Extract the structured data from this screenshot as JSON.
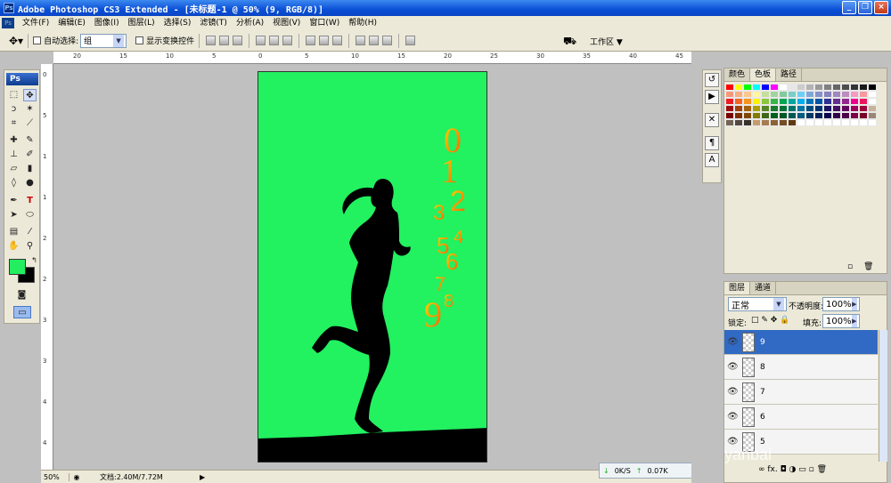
{
  "window": {
    "title": "Adobe Photoshop CS3 Extended - [未标题-1 @ 50% (9, RGB/8)]",
    "app_icon": "Ps"
  },
  "menu": {
    "items": [
      "文件(F)",
      "编辑(E)",
      "图像(I)",
      "图层(L)",
      "选择(S)",
      "滤镜(T)",
      "分析(A)",
      "视图(V)",
      "窗口(W)",
      "帮助(H)"
    ]
  },
  "options": {
    "auto_select_label": "自动选择:",
    "auto_select_value": "组",
    "show_transform_label": "显示变换控件",
    "workspace_label": "工作区"
  },
  "toolbox": {
    "logo": "Ps",
    "fg_color": "#22ee60",
    "bg_color": "#000000"
  },
  "rulers": {
    "top": [
      "20",
      "15",
      "10",
      "5",
      "0",
      "5",
      "10",
      "15",
      "20",
      "25",
      "30",
      "35",
      "40",
      "45"
    ],
    "left": [
      "0",
      "5",
      "1",
      "1",
      "2",
      "2",
      "3",
      "3",
      "4",
      "4"
    ]
  },
  "canvas": {
    "background": "#22f160",
    "digits": [
      "0",
      "1",
      "2",
      "3",
      "4",
      "5",
      "6",
      "7",
      "8",
      "9"
    ]
  },
  "status": {
    "zoom": "50%",
    "doc_info": "文档:2.40M/7.72M"
  },
  "download": {
    "speed_down": "0K/S",
    "speed_up": "0.07K"
  },
  "swatch_panel": {
    "tabs": [
      "颜色",
      "色板",
      "路径"
    ]
  },
  "layers_panel": {
    "tabs": [
      "图层",
      "通道"
    ],
    "blend_mode": "正常",
    "opacity_label": "不透明度:",
    "opacity_value": "100%",
    "lock_label": "锁定:",
    "fill_label": "填充:",
    "fill_value": "100%",
    "layers": [
      "9",
      "8",
      "7",
      "6",
      "5"
    ],
    "watermark": "yanbai"
  },
  "colors": {
    "swatches": [
      "#ff0000",
      "#ffff00",
      "#00ff00",
      "#00ffff",
      "#0000ff",
      "#ff00ff",
      "#ffffff",
      "#e6e6e6",
      "#cccccc",
      "#b3b3b3",
      "#999999",
      "#808080",
      "#666666",
      "#4d4d4d",
      "#333333",
      "#1a1a1a",
      "#000000",
      "#f7977a",
      "#f9ad81",
      "#fdc68a",
      "#fff79a",
      "#c4df9b",
      "#a2d39c",
      "#82ca9d",
      "#7bcdc8",
      "#6ecff6",
      "#7ea7d8",
      "#8493ca",
      "#8882be",
      "#a187be",
      "#bc8dbf",
      "#f49ac2",
      "#f6989d",
      "#ffffff",
      "#ed1c24",
      "#f26522",
      "#f7941d",
      "#fff200",
      "#8dc63f",
      "#39b54a",
      "#00a651",
      "#00a99d",
      "#00aeef",
      "#0072bc",
      "#0054a6",
      "#2e3192",
      "#662d91",
      "#92278f",
      "#ec008c",
      "#ed145b",
      "#ffffff",
      "#9e0b0f",
      "#a0410d",
      "#a3620a",
      "#aba000",
      "#598527",
      "#1a7b30",
      "#007236",
      "#00746b",
      "#0076a3",
      "#004b80",
      "#003471",
      "#1b1464",
      "#440e62",
      "#630460",
      "#9e005d",
      "#9e0039",
      "#c7b299",
      "#790000",
      "#7b2e00",
      "#7d4900",
      "#827b00",
      "#406618",
      "#005e20",
      "#005826",
      "#005952",
      "#005b7f",
      "#003663",
      "#002157",
      "#0d004c",
      "#32004b",
      "#4b0049",
      "#7b0046",
      "#7a0026",
      "#998675",
      "#736357",
      "#534741",
      "#37302a",
      "#c69c6d",
      "#a67c52",
      "#8c6239",
      "#754c24",
      "#603913",
      "#ffffff",
      "#ffffff",
      "#ffffff",
      "#ffffff",
      "#ffffff",
      "#ffffff",
      "#ffffff",
      "#ffffff",
      "#ffffff"
    ]
  }
}
